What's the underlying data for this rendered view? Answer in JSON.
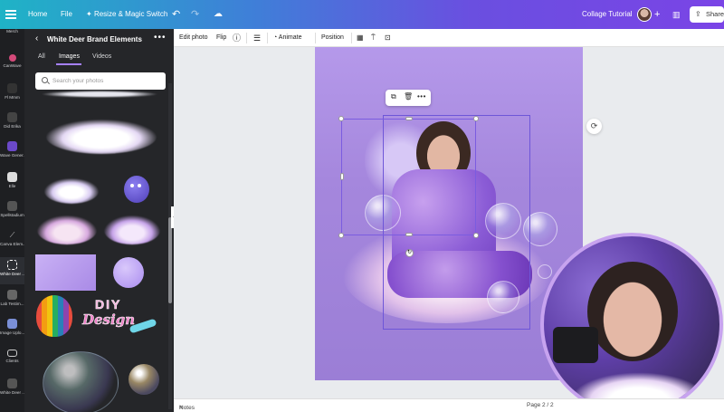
{
  "topbar": {
    "home": "Home",
    "file": "File",
    "resize": "Resize & Magic Switch",
    "design_title": "Collage Tutorial",
    "share": "Share"
  },
  "rail": {
    "items": [
      {
        "label": "Merch"
      },
      {
        "label": "CanWave"
      },
      {
        "label": "Fl Mmm"
      },
      {
        "label": "Did Erika"
      },
      {
        "label": "Wave Gener..."
      },
      {
        "label": "Elle"
      },
      {
        "label": "Spellstadium"
      },
      {
        "label": "Canva Elem..."
      },
      {
        "label": "White Deer ..."
      },
      {
        "label": "Lab Testim..."
      },
      {
        "label": "Image Uplo..."
      },
      {
        "label": "Clients"
      },
      {
        "label": "White Deer ..."
      }
    ]
  },
  "panel": {
    "title": "White Deer Brand Elements",
    "tabs": [
      "All",
      "Images",
      "Videos"
    ],
    "active_tab": "Images",
    "search_placeholder": "Search your photos",
    "asset_text": {
      "diy": "DIY",
      "design": "Design"
    }
  },
  "toolbar": {
    "edit_photo": "Edit photo",
    "flip": "Flip",
    "animate": "Animate",
    "position": "Position"
  },
  "bottom": {
    "notes": "Notes",
    "page": "Page 2 / 2"
  },
  "colors": {
    "accent": "#7d2ae8",
    "page_bg": "#a587dd",
    "selection": "#7b5ce0"
  }
}
